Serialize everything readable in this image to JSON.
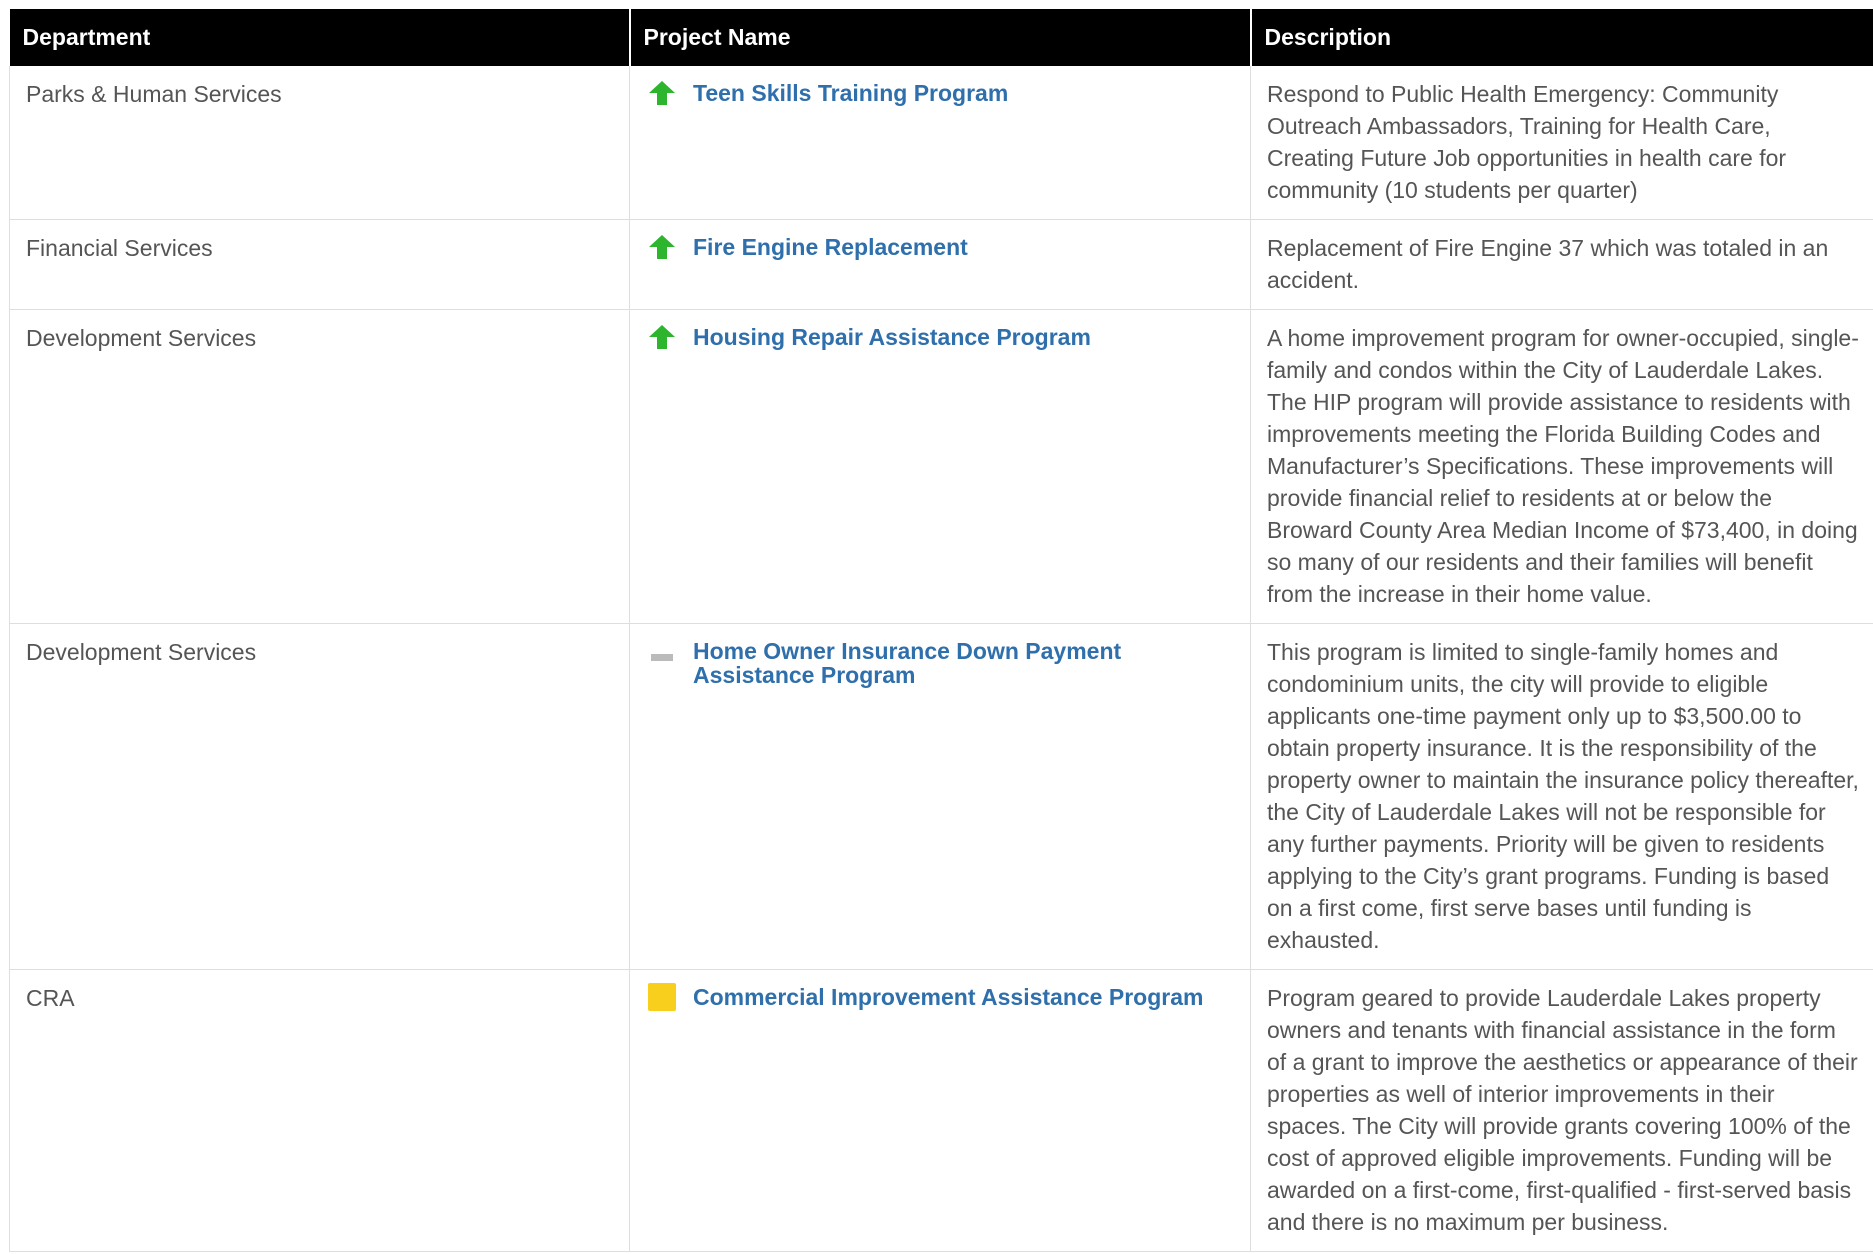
{
  "table": {
    "headers": {
      "department": "Department",
      "project_name": "Project Name",
      "description": "Description"
    },
    "colors": {
      "header_bg": "#000000",
      "link": "#2e6fac",
      "status_up": "#2db52d",
      "status_flat": "#bbbbbb",
      "status_square": "#f8cf1c"
    },
    "rows": [
      {
        "department": "Parks & Human Services",
        "status_icon": "arrow-up-icon",
        "project_name": "Teen Skills Training Program",
        "description": "Respond to Public Health Emergency: Community Outreach Ambassadors, Training for Health Care, Creating Future Job opportunities in health care for community (10 students per quarter)"
      },
      {
        "department": "Financial Services",
        "status_icon": "arrow-up-icon",
        "project_name": "Fire Engine Replacement",
        "description": "Replacement of Fire Engine 37 which was totaled in an accident."
      },
      {
        "department": "Development Services",
        "status_icon": "arrow-up-icon",
        "project_name": "Housing Repair Assistance Program",
        "description": "A home improvement program for owner-occupied, single-family and condos within the City of Lauderdale Lakes. The HIP program will provide assistance to residents with improvements meeting the Florida Building Codes and Manufacturer’s Specifications. These improvements will provide financial relief to residents at or below the Broward County Area Median Income of $73,400, in doing so many of our residents and their families will benefit from the increase in their home value."
      },
      {
        "department": "Development Services",
        "status_icon": "dash-icon",
        "project_name": "Home Owner Insurance Down Payment Assistance Program",
        "description": "This program is limited to single-family homes and condominium units, the city will provide to eligible applicants one-time payment only up to $3,500.00 to obtain property insurance. It is the responsibility of the property owner to maintain the insurance policy thereafter, the City of Lauderdale Lakes will not be responsible for any further payments. Priority will be given to residents applying to the City’s grant programs. Funding is based on a first come, first serve bases until funding is exhausted."
      },
      {
        "department": "CRA",
        "status_icon": "square-icon",
        "project_name": "Commercial Improvement Assistance Program",
        "description": "Program geared to provide Lauderdale Lakes property owners and tenants with financial assistance in the form of a grant to improve the aesthetics or appearance of their properties as well of interior improvements in their spaces. The City will provide grants covering 100% of the cost of approved eligible improvements. Funding will be awarded on a first-come, first-qualified - first-served basis and there is no maximum per business."
      }
    ]
  }
}
